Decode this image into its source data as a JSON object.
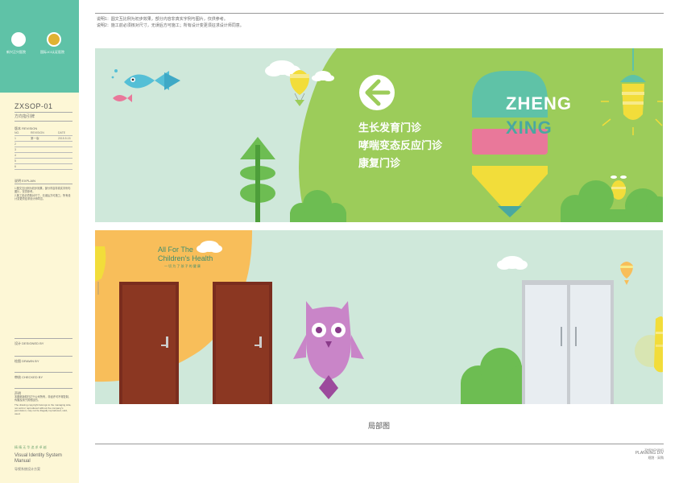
{
  "notes": [
    "说明1：圆文互比例为初步效果，部分内容非真实字例与图片，仅供参考。",
    "说明2：施工前必须核对尺寸，无误后方可施工；所有设计变更须征求设计师同意。"
  ],
  "sidebar": {
    "logo1_text": "新兴正兴医院",
    "logo2_text": "国际JCI认证医院",
    "code": "ZXSOP-01",
    "code_sub": "方向指引牌",
    "revisions_label": "版本 REVISION",
    "rev_head": {
      "no": "NO.",
      "revision": "REVISION",
      "date": "DATE"
    },
    "rev_rows": [
      {
        "no": "1",
        "revision": "第一版",
        "date": "2015.5.15"
      },
      {
        "no": "2",
        "revision": "",
        "date": ""
      },
      {
        "no": "3",
        "revision": "",
        "date": ""
      },
      {
        "no": "4",
        "revision": "",
        "date": ""
      },
      {
        "no": "5",
        "revision": "",
        "date": ""
      },
      {
        "no": "6",
        "revision": "",
        "date": ""
      }
    ],
    "explain_label": "说明 EXPLAIN",
    "explain_text_1": "1.图文互比例为初步效果，部分内容非真实字例与图片，仅供参考。",
    "explain_text_2": "2.施工前必须核对尺寸，无误后方可施工；所有设计变更须征求设计师同意。",
    "designed_by": "设计 DESIGNED BY",
    "drawn_by": "绘图 DRAWN BY",
    "checked_by": "审核 CHECKED BY",
    "statement_label": "声明",
    "statement_text": "本图纸版权归正兴公司所有，非经许可不得复制、传播及用于其他目的。",
    "statement_en": "The drawing copyright belongs to the managing side, not sold or reproduced without the company's permission; may not be illegally reproduced, sold, used.",
    "slogan": "精 精 无 华   追 求 卓 越",
    "bottom_title": "Visual Identity System Manual",
    "bottom_sub": "导视系统设计方案"
  },
  "panel1": {
    "lines": [
      "生长发育门诊",
      "哮喘变态反应门诊",
      "康复门诊"
    ],
    "brand_line1": "ZHENG",
    "brand_line2": "XING"
  },
  "panel2": {
    "tagline_line1": "All For The",
    "tagline_line2": "Children's Health",
    "tagline_cn": "一 切 为 了 孩 子 的 健 康"
  },
  "caption": "局部图",
  "footer": {
    "line1": "ZHENGXING",
    "line2": "PLANNING DIV",
    "line3": "规划 · 采购"
  },
  "colors": {
    "sidebar_teal": "#5fc2a7",
    "sidebar_cream": "#fdf7d6",
    "green_main": "#9ccc5a",
    "mint_bg": "#cfe8da",
    "teal_dark": "#4aa8a0",
    "pink": "#e9789a",
    "yellow": "#f2dd3a",
    "owl_purple": "#c985c8",
    "door_wood": "#7a2d1e",
    "sun_orange": "#f8be5a"
  },
  "icons": [
    "arrow-left-icon",
    "fish-icon",
    "cloud-icon",
    "balloon-icon",
    "tree-icon",
    "bush-icon",
    "lightbulb-icon",
    "bee-icon",
    "owl-icon",
    "door-icon",
    "sun-icon"
  ]
}
